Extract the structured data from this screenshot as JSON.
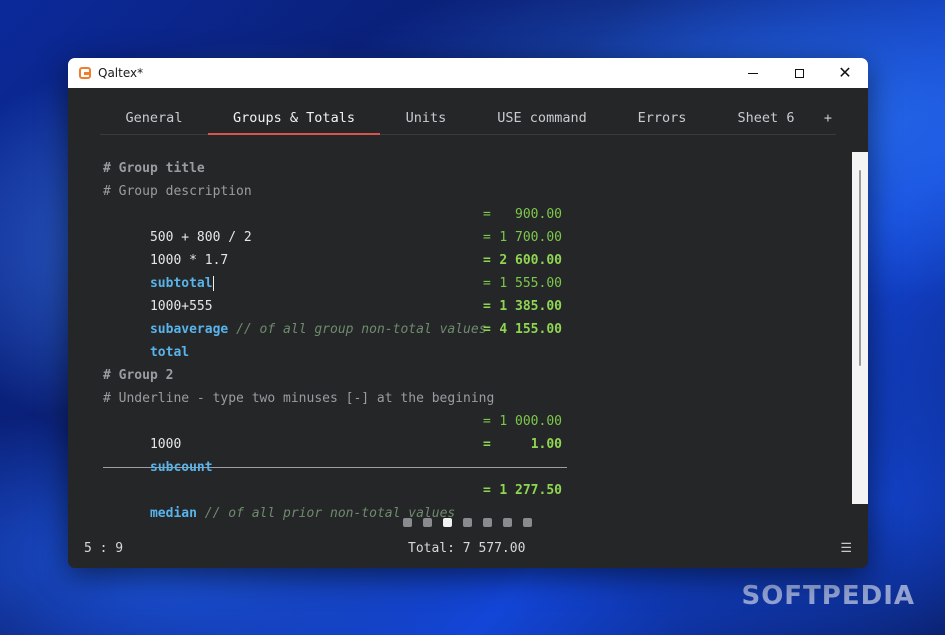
{
  "window": {
    "title": "Qaltex*"
  },
  "tabs": [
    {
      "label": "General"
    },
    {
      "label": "Groups & Totals"
    },
    {
      "label": "Units"
    },
    {
      "label": "USE command"
    },
    {
      "label": "Errors"
    },
    {
      "label": "Sheet 6"
    },
    {
      "label": "+"
    }
  ],
  "editor": {
    "lines": [
      {
        "text": "# Group title"
      },
      {
        "text": "# Group description"
      },
      {
        "text": "500 + 800 / 2",
        "eq": "=",
        "result": "900.00"
      },
      {
        "text": "1000 * 1.7",
        "eq": "=",
        "result": "1 700.00"
      },
      {
        "text": "subtotal",
        "eq": "=",
        "result": "2 600.00"
      },
      {
        "text": "1000+555",
        "eq": "=",
        "result": "1 555.00"
      },
      {
        "text": "subaverage",
        "comment": "// of all group non-total values",
        "eq": "=",
        "result": "1 385.00"
      },
      {
        "text": "total",
        "eq": "=",
        "result": "4 155.00"
      },
      {
        "text": ""
      },
      {
        "text": "# Group 2"
      },
      {
        "text": "# Underline - type two minuses [-] at the begining"
      },
      {
        "text": "1000",
        "eq": "=",
        "result": "1 000.00"
      },
      {
        "text": "subcount",
        "eq": "=",
        "result": "1.00"
      },
      {
        "text": "median",
        "comment": "// of all prior non-total values",
        "eq": "=",
        "result": "1 277.50"
      }
    ]
  },
  "pager": {
    "count": 7,
    "active": 3
  },
  "status": {
    "position": "5 : 9",
    "total": "Total: 7 577.00",
    "menu_icon": "☰"
  },
  "watermark": "SOFTPEDIA"
}
